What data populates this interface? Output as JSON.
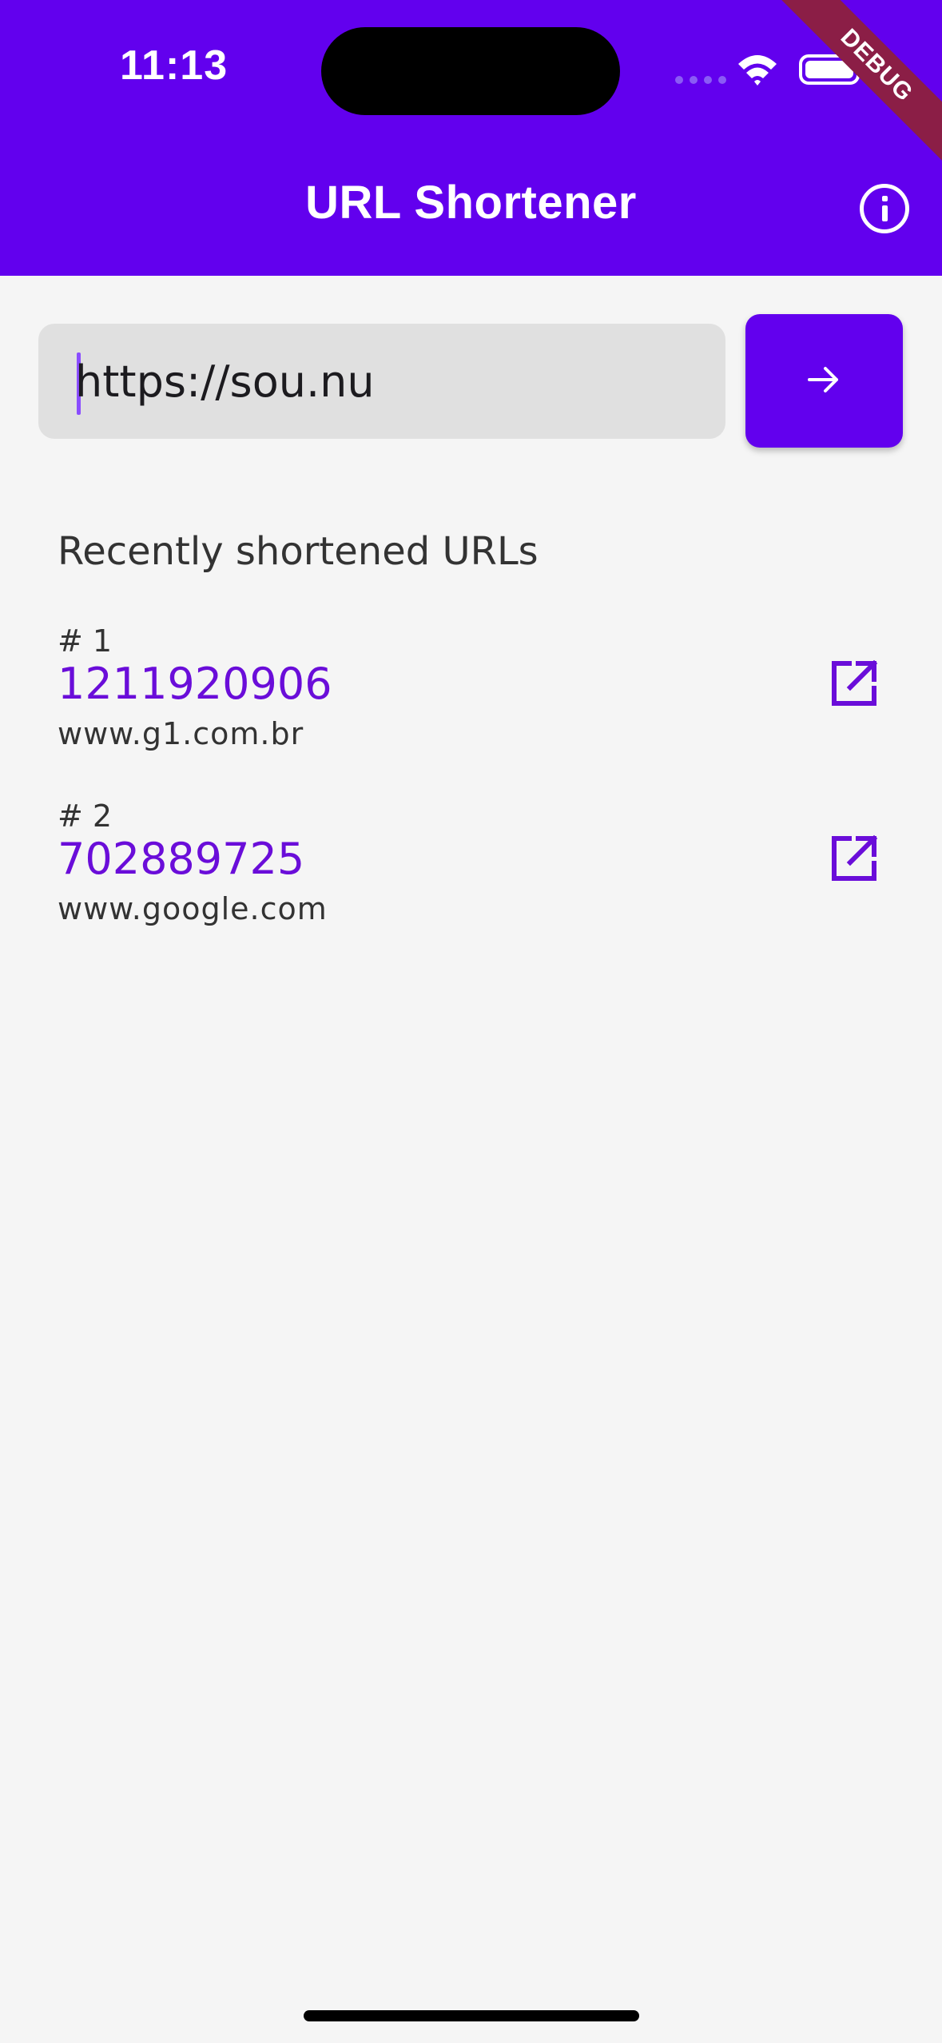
{
  "status_bar": {
    "time": "11:13"
  },
  "debug_banner": "DEBUG",
  "app_bar": {
    "title": "URL Shortener",
    "info_icon": "info-icon"
  },
  "input": {
    "value": "https://sou.nu",
    "placeholder": ""
  },
  "submit_icon": "arrow-right-icon",
  "recent": {
    "title": "Recently shortened URLs",
    "items": [
      {
        "index": "# 1",
        "code": "1211920906",
        "url": "www.g1.com.br",
        "icon": "open-in-new-icon"
      },
      {
        "index": "# 2",
        "code": "702889725",
        "url": "www.google.com",
        "icon": "open-in-new-icon"
      }
    ]
  },
  "colors": {
    "primary": "#6200ee",
    "link": "#6a0dd9",
    "background": "#f5f5f5",
    "field": "#e0e0e0",
    "debug": "#8b1e46"
  }
}
